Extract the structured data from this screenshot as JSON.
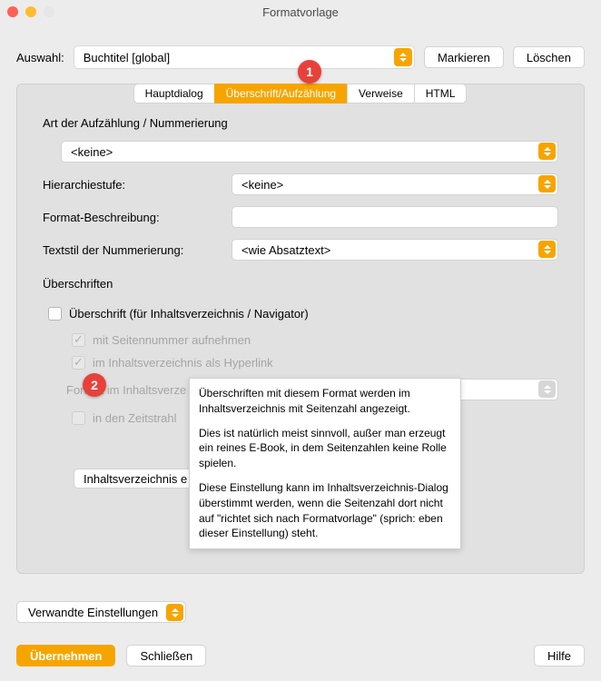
{
  "window": {
    "title": "Formatvorlage"
  },
  "auswahl": {
    "label": "Auswahl:",
    "value": "Buchtitel [global]",
    "markieren": "Markieren",
    "loeschen": "Löschen"
  },
  "tabs": {
    "hauptdialog": "Hauptdialog",
    "ueberschrift": "Überschrift/Aufzählung",
    "verweise": "Verweise",
    "html": "HTML"
  },
  "section1": {
    "title": "Art der Aufzählung / Nummerierung",
    "keine": "<keine>",
    "hierarchie_label": "Hierarchiestufe:",
    "hierarchie_value": "<keine>",
    "format_label": "Format-Beschreibung:",
    "format_value": "",
    "textstil_label": "Textstil der Nummerierung:",
    "textstil_value": "<wie Absatztext>"
  },
  "section2": {
    "title": "Überschriften",
    "checkbox_main": "Überschrift (für Inhaltsverzeichnis / Navigator)",
    "check1": "mit Seitennummer aufnehmen",
    "check2": "im Inhaltsverzeichnis als Hyperlink",
    "format_label": "Format im Inhaltsverze",
    "check3": "in den Zeitstrahl",
    "toc_button": "Inhaltsverzeichnis e"
  },
  "tooltip": {
    "p1": "Überschriften mit diesem Format werden im Inhaltsverzeichnis mit Seitenzahl angezeigt.",
    "p2": "Dies ist natürlich meist sinnvoll, außer man erzeugt ein reines E-Book, in dem Seitenzahlen keine Rolle spielen.",
    "p3": "Diese Einstellung kann im Inhaltsverzeichnis-Dialog überstimmt werden, wenn die Seitenzahl dort nicht auf \"richtet sich nach Formatvorlage\" (sprich: eben dieser Einstellung) steht."
  },
  "verwandte": "Verwandte Einstellungen",
  "footer": {
    "uebernehmen": "Übernehmen",
    "schliessen": "Schließen",
    "hilfe": "Hilfe"
  },
  "markers": {
    "m1": "1",
    "m2": "2"
  }
}
